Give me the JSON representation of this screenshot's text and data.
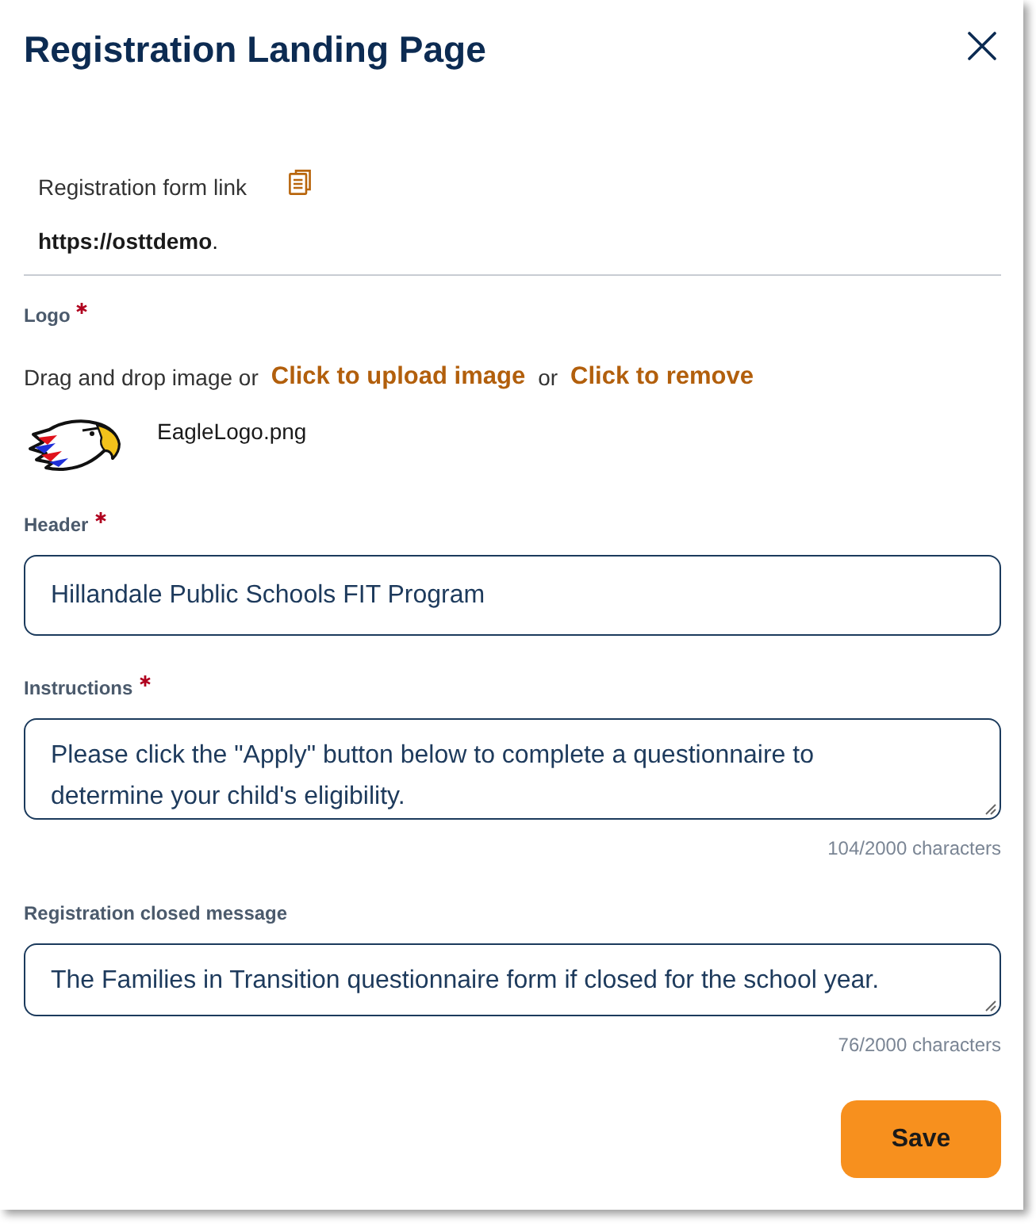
{
  "dialog": {
    "title": "Registration Landing Page"
  },
  "form_link": {
    "label": "Registration form link",
    "url": "**https://osttdemo**."
  },
  "logo": {
    "label": "Logo",
    "required": true,
    "upload_hint": "Drag and drop image or",
    "upload_link": "Click to upload image",
    "separator": "or",
    "remove_link": "Click to remove",
    "file_name": "EagleLogo.png"
  },
  "fields": [
    {
      "kind": "input",
      "label": "Header",
      "required": true,
      "value": "Hillandale Public Schools FIT Program"
    },
    {
      "kind": "textarea",
      "label": "Instructions",
      "required": true,
      "value": "Please click the \"Apply\" button below to complete a questionnaire to determine your child's eligibility.",
      "counter": "104/2000 characters"
    },
    {
      "kind": "textarea",
      "label": "Registration closed message",
      "required": false,
      "value": "The Families in Transition questionnaire form if closed for the school year.",
      "counter": "76/2000 characters"
    }
  ],
  "save_button": {
    "label": "Save"
  }
}
